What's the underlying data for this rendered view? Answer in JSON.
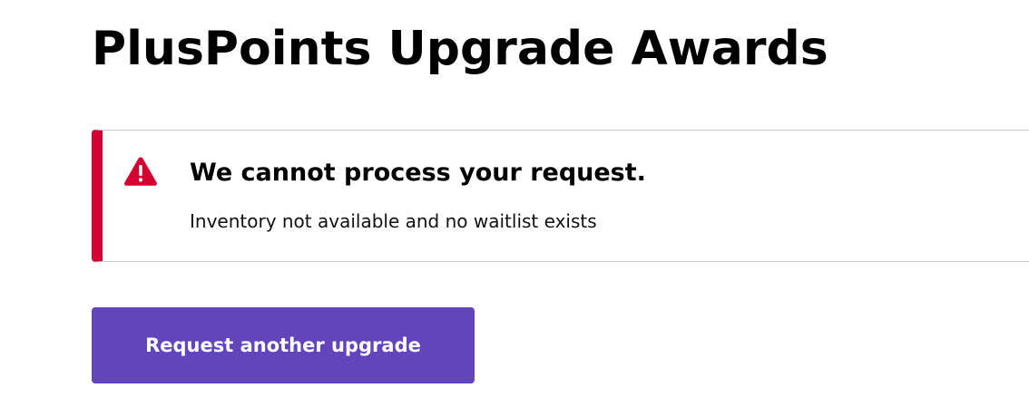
{
  "page": {
    "title": "PlusPoints Upgrade Awards"
  },
  "alert": {
    "type": "error",
    "icon": "warning-triangle-icon",
    "title": "We cannot process your request.",
    "message": "Inventory not available and no waitlist exists",
    "accent_color": "#d50032"
  },
  "actions": {
    "request_another_label": "Request another upgrade",
    "button_color": "#6244bb"
  }
}
